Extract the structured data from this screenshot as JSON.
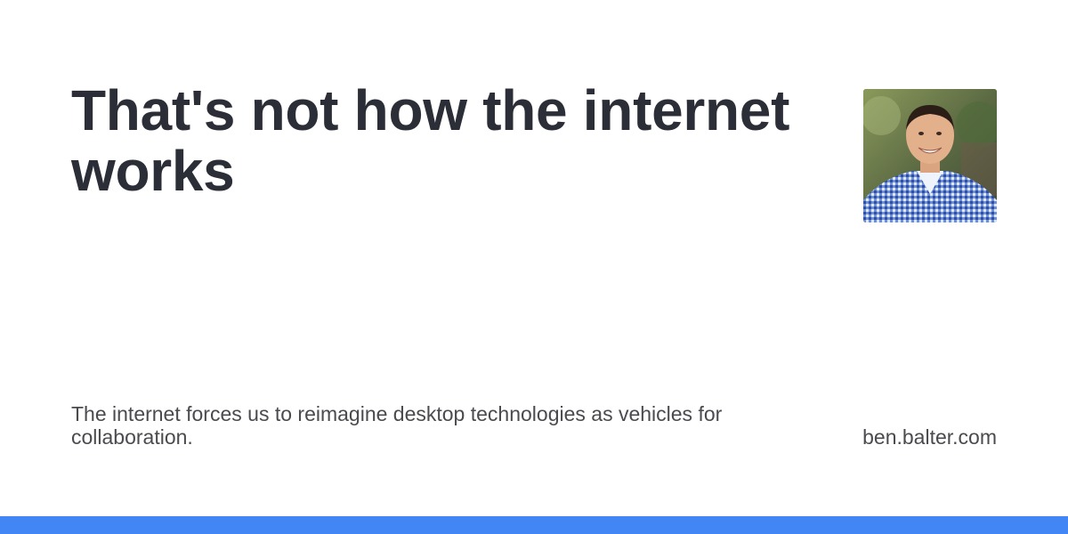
{
  "card": {
    "title": "That's not how the internet works",
    "description": "The internet forces us to reimagine desktop technologies as vehicles for collaboration.",
    "site": "ben.balter.com",
    "avatar_icon": "author-photo",
    "accent_color": "#4285f4",
    "title_color": "#2b2d37",
    "text_color": "#4a4a4f"
  }
}
